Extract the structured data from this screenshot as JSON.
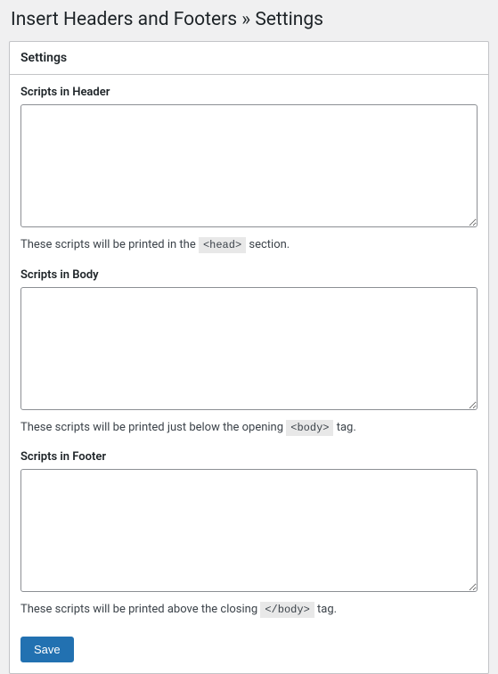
{
  "page": {
    "title": "Insert Headers and Footers » Settings"
  },
  "panel": {
    "title": "Settings"
  },
  "fields": {
    "header": {
      "label": "Scripts in Header",
      "value": "",
      "description_prefix": "These scripts will be printed in the ",
      "description_code": "<head>",
      "description_suffix": " section."
    },
    "body": {
      "label": "Scripts in Body",
      "value": "",
      "description_prefix": "These scripts will be printed just below the opening ",
      "description_code": "<body>",
      "description_suffix": " tag."
    },
    "footer": {
      "label": "Scripts in Footer",
      "value": "",
      "description_prefix": "These scripts will be printed above the closing ",
      "description_code": "</body>",
      "description_suffix": " tag."
    }
  },
  "actions": {
    "save_label": "Save"
  }
}
